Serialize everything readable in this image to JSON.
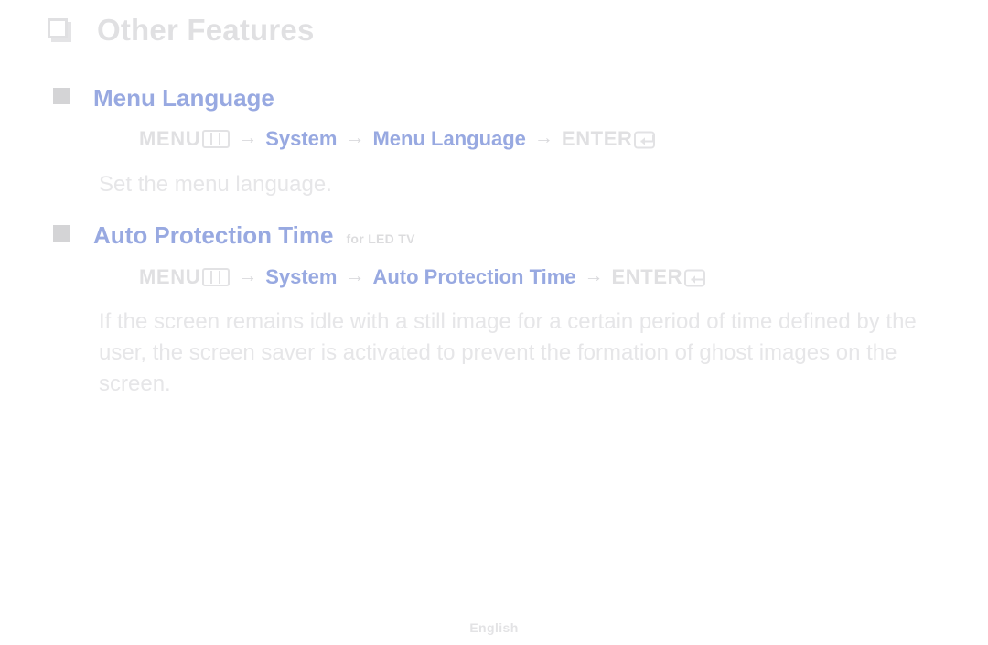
{
  "document": {
    "chapter": {
      "bullet_icon": "outline-square-bullet-icon",
      "title": "Other Features"
    },
    "sections": [
      {
        "bullet_icon": "filled-square-bullet-icon",
        "title": "Menu Language",
        "note": "",
        "path": {
          "menu_label": "MENU",
          "menu_icon": "menu-grid-icon",
          "arrow": "→",
          "step1": "System",
          "step2": "Menu Language",
          "enter_label": "ENTER",
          "enter_icon": "enter-key-icon"
        },
        "description": "Set the menu language."
      },
      {
        "bullet_icon": "filled-square-bullet-icon",
        "title": "Auto Protection Time",
        "note": "for LED TV",
        "path": {
          "menu_label": "MENU",
          "menu_icon": "menu-grid-icon",
          "arrow": "→",
          "step1": "System",
          "step2": "Auto Protection Time",
          "enter_label": "ENTER",
          "enter_icon": "enter-key-icon"
        },
        "description": "If the screen remains idle with a still image for a certain period of time defined by the user, the screen saver is activated to prevent the formation of ghost images on the screen."
      }
    ],
    "footer": {
      "language": "English"
    },
    "colors": {
      "accent_blue": "#98a9e1",
      "body_gray": "#e6e6e8",
      "heading_gray": "#e0e0e2",
      "bullet_gray": "#d4d4d6",
      "background": "#ffffff"
    }
  }
}
